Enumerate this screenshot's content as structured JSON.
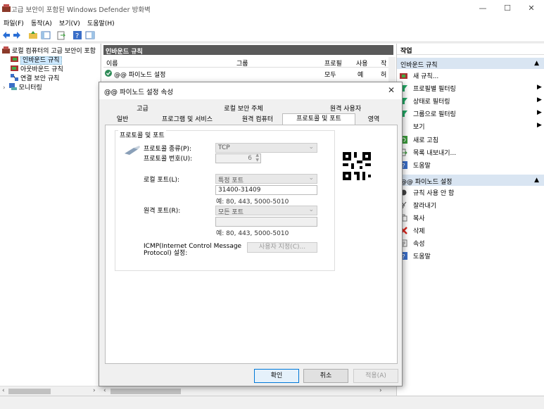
{
  "window": {
    "title": "고급 보안이 포함된 Windows Defender 방화벽",
    "controls": {
      "minimize": "—",
      "maximize": "☐",
      "close": "✕"
    }
  },
  "menu": [
    "파일(F)",
    "동작(A)",
    "보기(V)",
    "도움말(H)"
  ],
  "tree": {
    "root": "로컬 컴퓨터의 고급 보안이 포함",
    "items": [
      "인바운드 규칙",
      "아웃바운드 규칙",
      "연결 보안 규칙",
      "모니터링"
    ],
    "expander": "›"
  },
  "center": {
    "header": "인바운드 규칙",
    "columns": [
      "이름",
      "그룹",
      "프로필",
      "사용",
      "작"
    ],
    "row": {
      "name": "@@ 파이노드 설정",
      "profile": "모두",
      "enabled": "예",
      "action": "허"
    }
  },
  "actions": {
    "header": "작업",
    "section1": {
      "title": "인바운드 규칙",
      "items": [
        "새 규칙...",
        "프로필별 필터링",
        "상태로 필터링",
        "그룹으로 필터링",
        "보기",
        "새로 고침",
        "목록 내보내기...",
        "도움말"
      ]
    },
    "section2": {
      "title": "@@ 파이노드 설정",
      "items": [
        "규칙 사용 안 함",
        "잘라내기",
        "복사",
        "삭제",
        "속성",
        "도움말"
      ]
    },
    "collapse_arrow": "▲",
    "submenu_arrow": "▶"
  },
  "dialog": {
    "title": "@@ 파이노드 설정 속성",
    "close": "✕",
    "tabs_row1": [
      "고급",
      "로컬 보안 주체",
      "원격 사용자"
    ],
    "tabs_row2": [
      "일반",
      "프로그램 및 서비스",
      "원격 컴퓨터",
      "프로토콜 및 포트",
      "영역"
    ],
    "group_title": "프로토콜 및 포트",
    "protocol_type_label": "프로토콜 종류(P):",
    "protocol_type_value": "TCP",
    "protocol_number_label": "프로토콜 번호(U):",
    "protocol_number_value": "6",
    "local_port_label": "로컬 포트(L):",
    "local_port_mode": "특정 포트",
    "local_port_value": "31400-31409",
    "local_port_hint": "예: 80, 443, 5000-5010",
    "remote_port_label": "원격 포트(R):",
    "remote_port_mode": "모든 포트",
    "remote_port_value": "",
    "remote_port_hint": "예: 80, 443, 5000-5010",
    "icmp_label_line1": "ICMP(Internet Control Message",
    "icmp_label_line2": "Protocol) 설정:",
    "icmp_button": "사용자 지정(C)...",
    "ok": "확인",
    "cancel": "취소",
    "apply": "적용(A)"
  },
  "colors": {
    "section_bg": "#d9e5f2",
    "header_dark": "#5a5a5a",
    "accent": "#0078d7"
  }
}
